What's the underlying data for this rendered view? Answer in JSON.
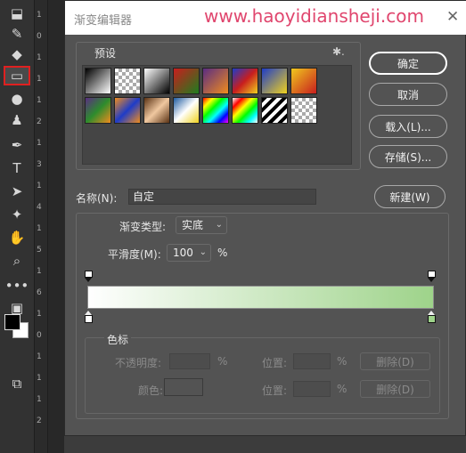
{
  "dialog": {
    "title": "渐变编辑器",
    "watermark": "www.haoyidiansheji.com",
    "close_glyph": "✕"
  },
  "toolbar": {
    "tools": [
      {
        "name": "stamp-tool",
        "glyph": "⬓"
      },
      {
        "name": "history-brush-tool",
        "glyph": "✎"
      },
      {
        "name": "eraser-tool",
        "glyph": "◆"
      },
      {
        "name": "gradient-tool",
        "glyph": "▭",
        "active": true
      },
      {
        "name": "blur-tool",
        "glyph": "●"
      },
      {
        "name": "dodge-tool",
        "glyph": "♟"
      },
      {
        "name": "pen-tool",
        "glyph": "✒"
      },
      {
        "name": "type-tool",
        "glyph": "T"
      },
      {
        "name": "path-selection-tool",
        "glyph": "➤"
      },
      {
        "name": "shape-tool",
        "glyph": "✦"
      },
      {
        "name": "hand-tool",
        "glyph": "✋"
      },
      {
        "name": "zoom-tool",
        "glyph": "⌕"
      },
      {
        "name": "more-tools",
        "glyph": "•••"
      },
      {
        "name": "quick-mask",
        "glyph": "▣"
      },
      {
        "name": "screen-mode",
        "glyph": "⧉"
      }
    ],
    "ruler_labels": [
      "1",
      "0",
      "1",
      "1",
      "1",
      "2",
      "1",
      "3",
      "1",
      "4",
      "1",
      "5",
      "1",
      "6",
      "1",
      "0",
      "1",
      "1",
      "1",
      "2"
    ]
  },
  "presets": {
    "label": "预设",
    "gear_glyph": "✱.",
    "swatches": [
      "linear-gradient(135deg,#000,#fff)",
      "repeating-conic-gradient(#aaa 0 25%,#fff 0 50%) 0 0/8px 8px",
      "linear-gradient(135deg,#fff,#000)",
      "linear-gradient(135deg,#c81e1e,#1e7d1e)",
      "linear-gradient(135deg,#5a2d82,#f08c1e)",
      "linear-gradient(135deg,#1e3cc8,#c81e1e,#f0d21e)",
      "linear-gradient(135deg,#1e3cc8,#f0d21e)",
      "linear-gradient(135deg,#f0c81e,#c81e1e)",
      "linear-gradient(135deg,#5a2d82,#2d8c2d,#f08c1e)",
      "linear-gradient(135deg,#f08c1e,#1e3cc8,#f08c1e)",
      "linear-gradient(135deg,#5a3214,#f0c8a0,#5a3214)",
      "linear-gradient(135deg,#1e5aa0,#fff,#f0d21e)",
      "linear-gradient(135deg,#f00,#ff0,#0f0,#0ff,#00f,#f0f)",
      "linear-gradient(135deg,#fff,#f00,#ff0,#0f0,#0ff,#fff)",
      "repeating-linear-gradient(135deg,#000 0 4px,#fff 4px 8px)",
      "repeating-conic-gradient(#aaa 0 25%,#fff 0 50%) 0 0/8px 8px"
    ]
  },
  "buttons": {
    "ok": "确定",
    "cancel": "取消",
    "load": "载入(L)...",
    "save": "存储(S)...",
    "new": "新建(W)"
  },
  "name_field": {
    "label": "名称(N):",
    "value": "自定"
  },
  "gradient": {
    "type_label": "渐变类型:",
    "type_value": "实底",
    "smoothness_label": "平滑度(M):",
    "smoothness_value": "100",
    "percent": "%",
    "start_color": "#ffffff",
    "end_color": "#9ed38a"
  },
  "stops": {
    "section_label": "色标",
    "opacity_label": "不透明度:",
    "opacity_percent": "%",
    "location_label_1": "位置:",
    "location_percent_1": "%",
    "delete_1": "删除(D)",
    "color_label": "颜色:",
    "location_label_2": "位置:",
    "location_percent_2": "%",
    "delete_2": "删除(D)"
  }
}
